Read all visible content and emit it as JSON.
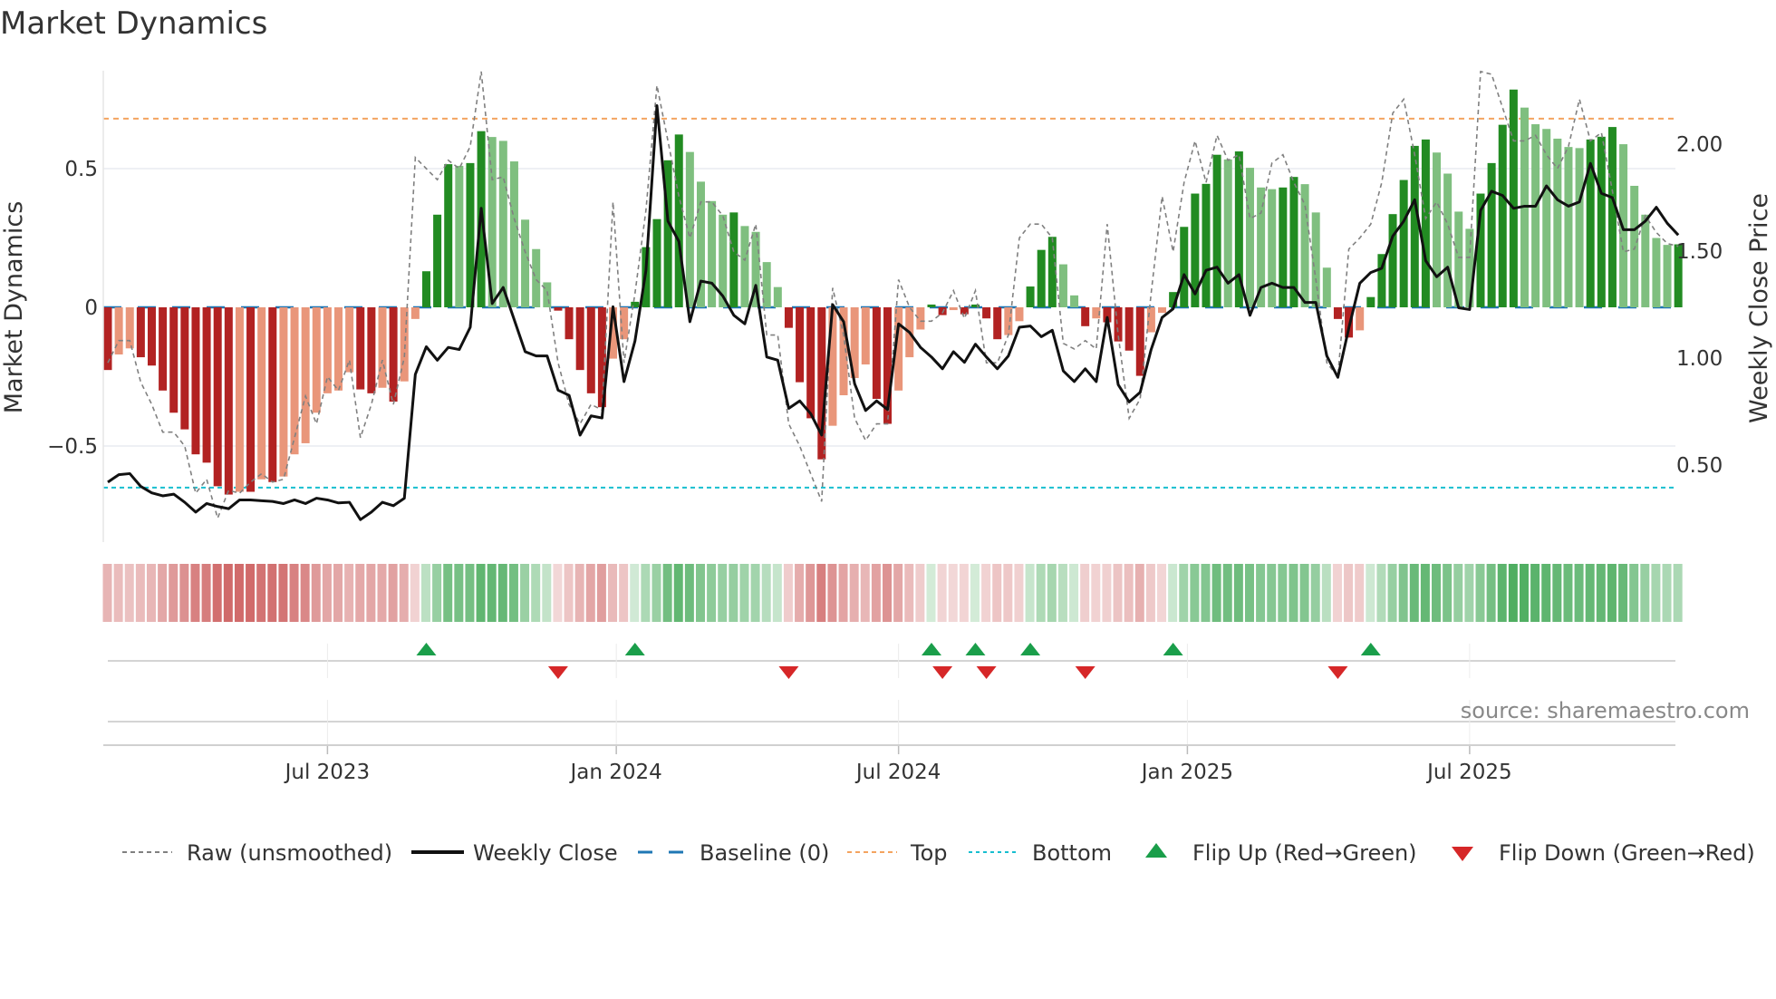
{
  "title": "Market Dynamics",
  "source": "source: sharemaestro.com",
  "colors": {
    "neg_strong": "#b22222",
    "neg_weak": "#e9967a",
    "pos_strong": "#228b22",
    "pos_weak": "#7fbf7f",
    "baseline": "#1f77b4",
    "top": "#f4a460",
    "bottom": "#17becf",
    "raw": "#808080",
    "close": "#111111",
    "flip_up": "#1a9e4a",
    "flip_down": "#d62728"
  },
  "chart_data": {
    "type": "bar",
    "title": "Market Dynamics",
    "ylabel": "Market Dynamics",
    "y2label": "Weekly Close Price",
    "ylim": [
      -0.85,
      0.85
    ],
    "y2lim": [
      0.25,
      2.35
    ],
    "yticks": [
      {
        "v": 0.5,
        "label": "0.5"
      },
      {
        "v": 0,
        "label": "0"
      },
      {
        "v": -0.5,
        "label": "−0.5"
      }
    ],
    "y2ticks": [
      {
        "v": 2.0,
        "label": "2.00"
      },
      {
        "v": 1.5,
        "label": "1.50"
      },
      {
        "v": 1.0,
        "label": "1.00"
      },
      {
        "v": 0.5,
        "label": "0.50"
      }
    ],
    "xticks": [
      {
        "week": 20,
        "label": "Jul 2023"
      },
      {
        "week": 46.3,
        "label": "Jan 2024"
      },
      {
        "week": 72,
        "label": "Jul 2024"
      },
      {
        "week": 98.3,
        "label": "Jan 2025"
      },
      {
        "week": 124,
        "label": "Jul 2025"
      }
    ],
    "x_unit": "week index (weekly bars)",
    "baseline": 0,
    "top": 0.68,
    "bottom": -0.65,
    "momentum": [
      -0.226,
      -0.17,
      -0.148,
      -0.18,
      -0.21,
      -0.3,
      -0.38,
      -0.44,
      -0.53,
      -0.56,
      -0.645,
      -0.675,
      -0.665,
      -0.665,
      -0.62,
      -0.63,
      -0.61,
      -0.53,
      -0.49,
      -0.38,
      -0.31,
      -0.3,
      -0.234,
      -0.296,
      -0.31,
      -0.29,
      -0.34,
      -0.267,
      -0.042,
      0.13,
      0.334,
      0.516,
      0.51,
      0.52,
      0.635,
      0.614,
      0.6,
      0.526,
      0.316,
      0.21,
      0.09,
      -0.012,
      -0.115,
      -0.226,
      -0.31,
      -0.36,
      -0.185,
      -0.115,
      0.02,
      0.217,
      0.318,
      0.53,
      0.623,
      0.56,
      0.453,
      0.383,
      0.334,
      0.342,
      0.293,
      0.272,
      0.163,
      0.073,
      -0.074,
      -0.27,
      -0.4,
      -0.548,
      -0.427,
      -0.317,
      -0.255,
      -0.206,
      -0.33,
      -0.42,
      -0.3,
      -0.18,
      -0.08,
      0.01,
      -0.028,
      -0.01,
      -0.025,
      0.01,
      -0.04,
      -0.115,
      -0.1,
      -0.05,
      0.075,
      0.207,
      0.254,
      0.155,
      0.043,
      -0.068,
      -0.04,
      -0.054,
      -0.123,
      -0.156,
      -0.247,
      -0.09,
      -0.02,
      0.055,
      0.29,
      0.41,
      0.445,
      0.55,
      0.533,
      0.562,
      0.503,
      0.432,
      0.426,
      0.432,
      0.47,
      0.444,
      0.342,
      0.143,
      -0.042,
      -0.109,
      -0.083,
      0.037,
      0.192,
      0.336,
      0.459,
      0.582,
      0.605,
      0.558,
      0.482,
      0.345,
      0.283,
      0.41,
      0.52,
      0.658,
      0.785,
      0.72,
      0.66,
      0.643,
      0.608,
      0.578,
      0.574,
      0.605,
      0.615,
      0.65,
      0.588,
      0.438,
      0.334,
      0.25,
      0.225,
      0.227
    ],
    "raw": [
      -0.2,
      -0.12,
      -0.12,
      -0.27,
      -0.35,
      -0.45,
      -0.45,
      -0.5,
      -0.67,
      -0.62,
      -0.76,
      -0.66,
      -0.67,
      -0.63,
      -0.6,
      -0.63,
      -0.62,
      -0.47,
      -0.32,
      -0.42,
      -0.25,
      -0.3,
      -0.19,
      -0.47,
      -0.35,
      -0.19,
      -0.35,
      -0.18,
      0.54,
      0.5,
      0.46,
      0.53,
      0.5,
      0.58,
      0.85,
      0.46,
      0.47,
      0.32,
      0.2,
      0.1,
      0.06,
      -0.2,
      -0.35,
      -0.42,
      -0.35,
      -0.37,
      0.38,
      -0.2,
      0.05,
      0.35,
      0.8,
      0.6,
      0.4,
      0.25,
      0.38,
      0.38,
      0.33,
      0.2,
      0.17,
      0.3,
      -0.1,
      -0.1,
      -0.42,
      -0.5,
      -0.6,
      -0.7,
      0.07,
      -0.1,
      -0.4,
      -0.48,
      -0.42,
      -0.42,
      0.1,
      0.0,
      -0.05,
      -0.05,
      -0.02,
      0.06,
      -0.04,
      0.06,
      -0.2,
      -0.2,
      -0.1,
      0.25,
      0.3,
      0.3,
      0.25,
      -0.13,
      -0.15,
      -0.12,
      -0.15,
      0.3,
      -0.1,
      -0.4,
      -0.33,
      0.05,
      0.4,
      0.2,
      0.45,
      0.6,
      0.45,
      0.62,
      0.53,
      0.55,
      0.32,
      0.34,
      0.52,
      0.55,
      0.45,
      0.37,
      0.1,
      -0.2,
      -0.25,
      0.21,
      0.25,
      0.3,
      0.45,
      0.7,
      0.75,
      0.55,
      0.32,
      0.38,
      0.3,
      0.18,
      0.18,
      0.85,
      0.84,
      0.72,
      0.6,
      0.6,
      0.62,
      0.55,
      0.5,
      0.58,
      0.75,
      0.6,
      0.63,
      0.42,
      0.2,
      0.21,
      0.33,
      0.27,
      0.23,
      0.22
    ],
    "weekly_close": [
      0.42,
      0.455,
      0.46,
      0.4,
      0.37,
      0.356,
      0.364,
      0.326,
      0.28,
      0.32,
      0.306,
      0.296,
      0.337,
      0.337,
      0.333,
      0.33,
      0.32,
      0.337,
      0.32,
      0.345,
      0.337,
      0.323,
      0.326,
      0.245,
      0.28,
      0.326,
      0.31,
      0.345,
      0.924,
      1.053,
      0.99,
      1.05,
      1.04,
      1.144,
      1.7,
      1.255,
      1.33,
      1.18,
      1.03,
      1.01,
      1.01,
      0.85,
      0.826,
      0.64,
      0.73,
      0.72,
      1.24,
      0.89,
      1.08,
      1.41,
      2.18,
      1.64,
      1.545,
      1.17,
      1.36,
      1.35,
      1.29,
      1.2,
      1.16,
      1.34,
      1.005,
      0.99,
      0.765,
      0.8,
      0.74,
      0.64,
      1.25,
      1.17,
      0.88,
      0.755,
      0.8,
      0.76,
      1.16,
      1.12,
      1.05,
      1.005,
      0.95,
      1.03,
      0.98,
      1.065,
      1.005,
      0.95,
      1.01,
      1.144,
      1.15,
      1.1,
      1.13,
      0.94,
      0.89,
      0.95,
      0.89,
      1.19,
      0.876,
      0.795,
      0.84,
      1.04,
      1.19,
      1.23,
      1.39,
      1.3,
      1.41,
      1.425,
      1.35,
      1.39,
      1.2,
      1.33,
      1.35,
      1.33,
      1.33,
      1.26,
      1.26,
      1.01,
      0.91,
      1.14,
      1.35,
      1.4,
      1.42,
      1.57,
      1.64,
      1.74,
      1.455,
      1.38,
      1.425,
      1.235,
      1.227,
      1.69,
      1.78,
      1.76,
      1.7,
      1.71,
      1.71,
      1.805,
      1.74,
      1.71,
      1.73,
      1.91,
      1.77,
      1.75,
      1.6,
      1.6,
      1.64,
      1.705,
      1.63,
      1.575
    ],
    "flip_up": [
      29,
      48,
      75,
      79,
      84,
      97,
      115
    ],
    "flip_down": [
      41,
      62,
      76,
      80,
      89,
      112
    ],
    "legend": {
      "placement": "bottom",
      "items": [
        "Raw (unsmoothed)",
        "Weekly Close",
        "Baseline (0)",
        "Top",
        "Bottom",
        "Flip Up (Red→Green)",
        "Flip Down (Green→Red)"
      ]
    }
  }
}
